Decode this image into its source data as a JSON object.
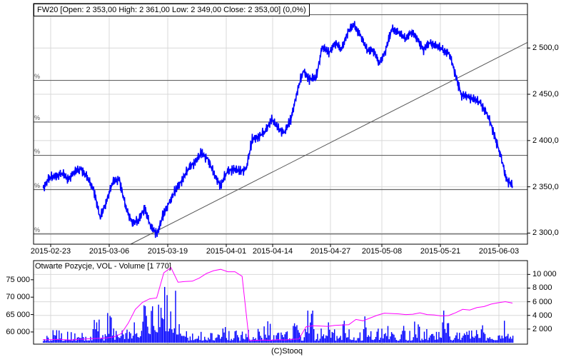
{
  "chart_data": [
    {
      "type": "line",
      "title": "FW20 [Open: 2 353,00  High: 2 361,00  Low: 2 349,00  Close: 2 353,00] (0,0%)",
      "x_tick_labels": [
        "2015-02-23",
        "2015-03-06",
        "2015-03-19",
        "2015-04-01",
        "2015-04-14",
        "2015-04-27",
        "2015-05-08",
        "2015-05-21",
        "2015-06-03"
      ],
      "y_tick_labels": [
        "2 500,0",
        "2 450,0",
        "2 400,0",
        "2 350,0",
        "2 300,0"
      ],
      "y_ticks": [
        2500,
        2450,
        2400,
        2350,
        2300
      ],
      "ylim": [
        2288,
        2548
      ],
      "fib_levels": [
        2536,
        2465,
        2420,
        2384,
        2347,
        2299
      ],
      "fib_label": "%",
      "trendline": {
        "from": 2288,
        "to": 2506
      },
      "series": [
        {
          "name": "FW20",
          "color": "#0000ff",
          "values": [
            2349,
            2359,
            2362,
            2364,
            2359,
            2366,
            2370,
            2359,
            2347,
            2316,
            2335,
            2355,
            2359,
            2328,
            2312,
            2312,
            2328,
            2306,
            2300,
            2320,
            2335,
            2347,
            2359,
            2370,
            2378,
            2386,
            2380,
            2362,
            2352,
            2366,
            2370,
            2366,
            2370,
            2401,
            2405,
            2409,
            2424,
            2413,
            2409,
            2421,
            2452,
            2475,
            2467,
            2467,
            2502,
            2494,
            2506,
            2498,
            2517,
            2525,
            2514,
            2498,
            2498,
            2483,
            2498,
            2521,
            2517,
            2510,
            2517,
            2510,
            2498,
            2506,
            2502,
            2498,
            2494,
            2471,
            2448,
            2448,
            2444,
            2440,
            2428,
            2409,
            2386,
            2359,
            2351
          ]
        }
      ],
      "grid": true
    },
    {
      "type": "bar",
      "title": "Otwarte Pozycje, VOL - Volume [1 770]",
      "left_axis": {
        "labels": [
          "75 000",
          "70 000",
          "65 000",
          "60 000"
        ],
        "ticks": [
          75000,
          70000,
          65000,
          60000
        ],
        "range": [
          56500,
          80500
        ]
      },
      "right_axis": {
        "labels": [
          "10 000",
          "8 000",
          "6 000",
          "4 000",
          "2 000"
        ],
        "ticks": [
          10000,
          8000,
          6000,
          4000,
          2000
        ],
        "range": [
          0,
          11500
        ]
      },
      "series": [
        {
          "name": "Otwarte Pozycje",
          "color": "#ff00ff",
          "axis": "left",
          "values": [
            57800,
            57800,
            57900,
            57800,
            57700,
            57900,
            58000,
            58100,
            58200,
            58300,
            58600,
            59500,
            62500,
            66500,
            68500,
            69500,
            69800,
            77000,
            78500,
            74300,
            74500,
            74600,
            75500,
            76800,
            77600,
            78000,
            77300,
            77300,
            76000,
            57500,
            57600,
            57700,
            57600,
            57800,
            57700,
            57900,
            58000,
            61500,
            61800,
            61700,
            61600,
            61900,
            62000,
            62100,
            63600,
            63200,
            64000,
            64800,
            65400,
            65300,
            65200,
            65000,
            65100,
            65500,
            65000,
            64900,
            64600,
            64700,
            65500,
            66500,
            66300,
            67000,
            67300,
            68000,
            68400,
            68700,
            68300
          ]
        },
        {
          "name": "Volume",
          "color": "#0000ff",
          "axis": "right",
          "values": [
            1500,
            2000,
            1800,
            2500,
            1800,
            1500,
            2200,
            5000,
            1500,
            4500,
            2000,
            2500,
            3000,
            4500,
            6000,
            8000,
            9000,
            11000,
            8000,
            5500,
            2000,
            2500,
            2000,
            1800,
            1500,
            2500,
            2000,
            1800,
            2000,
            1800,
            2200,
            4500,
            2000,
            2500,
            2000,
            3000,
            2000,
            5000,
            2000,
            2500,
            4800,
            2000,
            4000,
            2200,
            2000,
            5200,
            2000,
            2500,
            3000,
            2000,
            2500,
            2000,
            4500,
            2000,
            2500,
            2000,
            5000,
            2000,
            2500,
            2200,
            2000,
            4500,
            2000,
            2500,
            4000,
            2000,
            2000
          ]
        }
      ]
    }
  ],
  "footer": "(C)Stooq"
}
